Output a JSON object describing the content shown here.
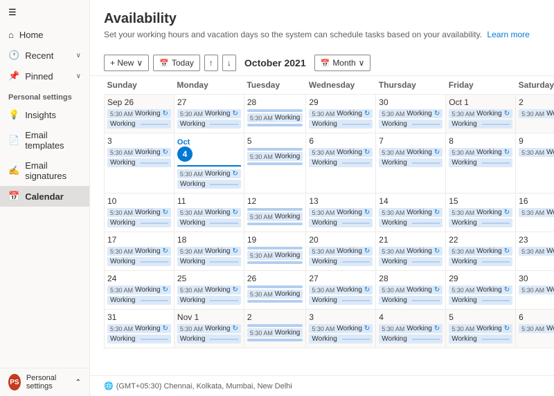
{
  "sidebar": {
    "hamburger_icon": "☰",
    "nav_items": [
      {
        "id": "home",
        "label": "Home",
        "icon": "⌂",
        "has_chevron": false
      },
      {
        "id": "recent",
        "label": "Recent",
        "icon": "🕐",
        "has_chevron": true
      },
      {
        "id": "pinned",
        "label": "Pinned",
        "icon": "📌",
        "has_chevron": true
      }
    ],
    "section_label": "Personal settings",
    "settings_items": [
      {
        "id": "insights",
        "label": "Insights",
        "icon": "💡",
        "active": false
      },
      {
        "id": "email-templates",
        "label": "Email templates",
        "icon": "📄",
        "active": false
      },
      {
        "id": "email-signatures",
        "label": "Email signatures",
        "icon": "✍",
        "active": false
      },
      {
        "id": "calendar",
        "label": "Calendar",
        "icon": "📅",
        "active": true
      }
    ],
    "bottom": {
      "avatar": "PS",
      "label": "Personal settings",
      "chevron": "⌃"
    }
  },
  "page": {
    "title": "Availability",
    "subtitle": "Set your working hours and vacation days so the system can schedule tasks based on your availability.",
    "learn_more": "Learn more"
  },
  "toolbar": {
    "new_label": "+ New",
    "today_label": "Today",
    "up_arrow": "↑",
    "down_arrow": "↓",
    "month_label": "October 2021",
    "calendar_icon": "📅",
    "month_view": "Month",
    "chevron_down": "∨"
  },
  "calendar": {
    "headers": [
      "Sunday",
      "Monday",
      "Tuesday",
      "Wednesday",
      "Thursday",
      "Friday",
      "Saturday"
    ],
    "footer": "(GMT+05:30) Chennai, Kolkata, Mumbai, New Delhi",
    "weeks": [
      {
        "days": [
          {
            "num": "Sep 26",
            "other": true,
            "events": [
              {
                "time": "5:30 AM",
                "label": "Working",
                "refresh": true
              },
              {
                "label": "Working",
                "line": true
              }
            ]
          },
          {
            "num": "27",
            "other": false,
            "events": [
              {
                "time": "5:30 AM",
                "label": "Working",
                "refresh": true
              },
              {
                "label": "Working",
                "line": true
              }
            ]
          },
          {
            "num": "28",
            "other": false,
            "events": [
              {
                "line": true
              },
              {
                "time": "5:30 AM",
                "label": "Working",
                "refresh": false
              },
              {
                "line": true
              }
            ]
          },
          {
            "num": "29",
            "other": false,
            "events": [
              {
                "time": "5:30 AM",
                "label": "Working",
                "refresh": true
              },
              {
                "label": "Working",
                "line": true
              }
            ]
          },
          {
            "num": "30",
            "other": false,
            "events": [
              {
                "time": "5:30 AM",
                "label": "Working",
                "refresh": true
              },
              {
                "label": "Working",
                "line": true
              }
            ]
          },
          {
            "num": "Oct 1",
            "other": true,
            "events": [
              {
                "time": "5:30 AM",
                "label": "Working",
                "refresh": true
              },
              {
                "label": "Working",
                "line": true
              }
            ]
          },
          {
            "num": "2",
            "other": true,
            "events": [
              {
                "time": "5:30 AM",
                "label": "Working",
                "refresh": false
              }
            ]
          }
        ]
      },
      {
        "days": [
          {
            "num": "3",
            "other": false,
            "events": [
              {
                "time": "5:30 AM",
                "label": "Working",
                "refresh": true
              },
              {
                "label": "Working",
                "line": true
              }
            ]
          },
          {
            "num": "Oct 4",
            "other": false,
            "today": true,
            "events": [
              {
                "time": "5:30 AM",
                "label": "Working",
                "refresh": true
              },
              {
                "label": "Working",
                "line": true
              }
            ]
          },
          {
            "num": "5",
            "other": false,
            "events": [
              {
                "line": true
              },
              {
                "time": "5:30 AM",
                "label": "Working",
                "refresh": false
              },
              {
                "line": true
              }
            ]
          },
          {
            "num": "6",
            "other": false,
            "events": [
              {
                "time": "5:30 AM",
                "label": "Working",
                "refresh": true
              },
              {
                "label": "Working",
                "line": true
              }
            ]
          },
          {
            "num": "7",
            "other": false,
            "events": [
              {
                "time": "5:30 AM",
                "label": "Working",
                "refresh": true
              },
              {
                "label": "Working",
                "line": true
              }
            ]
          },
          {
            "num": "8",
            "other": false,
            "events": [
              {
                "time": "5:30 AM",
                "label": "Working",
                "refresh": true
              },
              {
                "label": "Working",
                "line": true
              }
            ]
          },
          {
            "num": "9",
            "other": false,
            "events": [
              {
                "time": "5:30 AM",
                "label": "Working",
                "refresh": false
              }
            ]
          }
        ]
      },
      {
        "days": [
          {
            "num": "10",
            "other": false,
            "events": [
              {
                "time": "5:30 AM",
                "label": "Working",
                "refresh": true
              },
              {
                "label": "Working",
                "line": true
              }
            ]
          },
          {
            "num": "11",
            "other": false,
            "events": [
              {
                "time": "5:30 AM",
                "label": "Working",
                "refresh": true
              },
              {
                "label": "Working",
                "line": true
              }
            ]
          },
          {
            "num": "12",
            "other": false,
            "events": [
              {
                "line": true
              },
              {
                "time": "5:30 AM",
                "label": "Working",
                "refresh": false
              },
              {
                "line": true
              }
            ]
          },
          {
            "num": "13",
            "other": false,
            "events": [
              {
                "time": "5:30 AM",
                "label": "Working",
                "refresh": true
              },
              {
                "label": "Working",
                "line": true
              }
            ]
          },
          {
            "num": "14",
            "other": false,
            "events": [
              {
                "time": "5:30 AM",
                "label": "Working",
                "refresh": true
              },
              {
                "label": "Working",
                "line": true
              }
            ]
          },
          {
            "num": "15",
            "other": false,
            "events": [
              {
                "time": "5:30 AM",
                "label": "Working",
                "refresh": true
              },
              {
                "label": "Working",
                "line": true
              }
            ]
          },
          {
            "num": "16",
            "other": false,
            "events": [
              {
                "time": "5:30 AM",
                "label": "Working",
                "refresh": false
              }
            ]
          }
        ]
      },
      {
        "days": [
          {
            "num": "17",
            "other": false,
            "events": [
              {
                "time": "5:30 AM",
                "label": "Working",
                "refresh": true
              },
              {
                "label": "Working",
                "line": true
              }
            ]
          },
          {
            "num": "18",
            "other": false,
            "events": [
              {
                "time": "5:30 AM",
                "label": "Working",
                "refresh": true
              },
              {
                "label": "Working",
                "line": true
              }
            ]
          },
          {
            "num": "19",
            "other": false,
            "events": [
              {
                "line": true
              },
              {
                "time": "5:30 AM",
                "label": "Working",
                "refresh": false
              },
              {
                "line": true
              }
            ]
          },
          {
            "num": "20",
            "other": false,
            "events": [
              {
                "time": "5:30 AM",
                "label": "Working",
                "refresh": true
              },
              {
                "label": "Working",
                "line": true
              }
            ]
          },
          {
            "num": "21",
            "other": false,
            "events": [
              {
                "time": "5:30 AM",
                "label": "Working",
                "refresh": true
              },
              {
                "label": "Working",
                "line": true
              }
            ]
          },
          {
            "num": "22",
            "other": false,
            "events": [
              {
                "time": "5:30 AM",
                "label": "Working",
                "refresh": true
              },
              {
                "label": "Working",
                "line": true
              }
            ]
          },
          {
            "num": "23",
            "other": false,
            "events": [
              {
                "time": "5:30 AM",
                "label": "Working",
                "refresh": false
              }
            ]
          }
        ]
      },
      {
        "days": [
          {
            "num": "24",
            "other": false,
            "events": [
              {
                "time": "5:30 AM",
                "label": "Working",
                "refresh": true
              },
              {
                "label": "Working",
                "line": true
              }
            ]
          },
          {
            "num": "25",
            "other": false,
            "events": [
              {
                "time": "5:30 AM",
                "label": "Working",
                "refresh": true
              },
              {
                "label": "Working",
                "line": true
              }
            ]
          },
          {
            "num": "26",
            "other": false,
            "events": [
              {
                "line": true
              },
              {
                "time": "5:30 AM",
                "label": "Working",
                "refresh": false
              },
              {
                "line": true
              }
            ]
          },
          {
            "num": "27",
            "other": false,
            "events": [
              {
                "time": "5:30 AM",
                "label": "Working",
                "refresh": true
              },
              {
                "label": "Working",
                "line": true
              }
            ]
          },
          {
            "num": "28",
            "other": false,
            "events": [
              {
                "time": "5:30 AM",
                "label": "Working",
                "refresh": true
              },
              {
                "label": "Working",
                "line": true
              }
            ]
          },
          {
            "num": "29",
            "other": false,
            "events": [
              {
                "time": "5:30 AM",
                "label": "Working",
                "refresh": true
              },
              {
                "label": "Working",
                "line": true
              }
            ]
          },
          {
            "num": "30",
            "other": false,
            "events": [
              {
                "time": "5:30 AM",
                "label": "Working",
                "refresh": false
              }
            ]
          }
        ]
      },
      {
        "days": [
          {
            "num": "31",
            "other": false,
            "events": [
              {
                "time": "5:30 AM",
                "label": "Working",
                "refresh": true
              },
              {
                "label": "Working",
                "line": true
              }
            ]
          },
          {
            "num": "Nov 1",
            "other": true,
            "events": [
              {
                "time": "5:30 AM",
                "label": "Working",
                "refresh": true
              },
              {
                "label": "Working",
                "line": true
              }
            ]
          },
          {
            "num": "2",
            "other": true,
            "events": [
              {
                "line": true
              },
              {
                "time": "5:30 AM",
                "label": "Working",
                "refresh": false
              },
              {
                "line": true
              }
            ]
          },
          {
            "num": "3",
            "other": true,
            "events": [
              {
                "time": "5:30 AM",
                "label": "Working",
                "refresh": true
              },
              {
                "label": "Working",
                "line": true
              }
            ]
          },
          {
            "num": "4",
            "other": true,
            "events": [
              {
                "time": "5:30 AM",
                "label": "Working",
                "refresh": true
              },
              {
                "label": "Working",
                "line": true
              }
            ]
          },
          {
            "num": "5",
            "other": true,
            "events": [
              {
                "time": "5:30 AM",
                "label": "Working",
                "refresh": true
              },
              {
                "label": "Working",
                "line": true
              }
            ]
          },
          {
            "num": "6",
            "other": true,
            "events": [
              {
                "time": "5:30 AM",
                "label": "Working",
                "refresh": false
              }
            ]
          }
        ]
      }
    ]
  }
}
